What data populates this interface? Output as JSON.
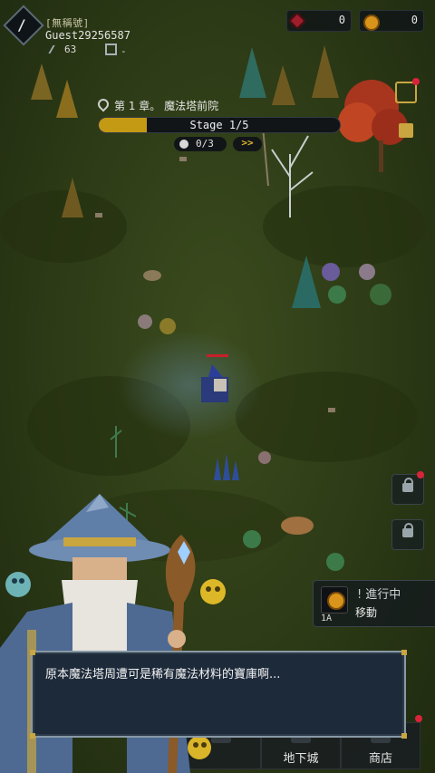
{
  "profile": {
    "avatar_glyph": "/",
    "tag": "[無稱號]",
    "name": "Guest29256587",
    "power": "63",
    "sub_value": "-"
  },
  "resources": {
    "gems": "0",
    "coins": "0"
  },
  "chapter": {
    "title": "第 1 章。 魔法塔前院",
    "stage_label": "Stage 1/5",
    "stage_progress": 0.2,
    "kills": "0/3",
    "fast_forward": ">>"
  },
  "quest": {
    "status": "進行中",
    "task": "移動",
    "level": "1A"
  },
  "nav": {
    "dungeon": "地下城",
    "shop": "商店"
  },
  "dialog": {
    "text": "原本魔法塔周遭可是稀有魔法材料的寶庫啊..."
  },
  "colors": {
    "grass_dark": "#1f2a10",
    "grass_mid": "#3c4c1e",
    "stage_fill": "#c49a14",
    "dialog_bg": "#1d2a3a",
    "dialog_border": "#8899a6",
    "gem": "#9d1f2b",
    "coin": "#d9951b"
  },
  "icons": {
    "avatar": "avatar-icon",
    "gem": "gem-icon",
    "coin": "coin-icon",
    "pin": "map-pin-icon",
    "skull": "skull-icon",
    "lock": "lock-icon"
  }
}
